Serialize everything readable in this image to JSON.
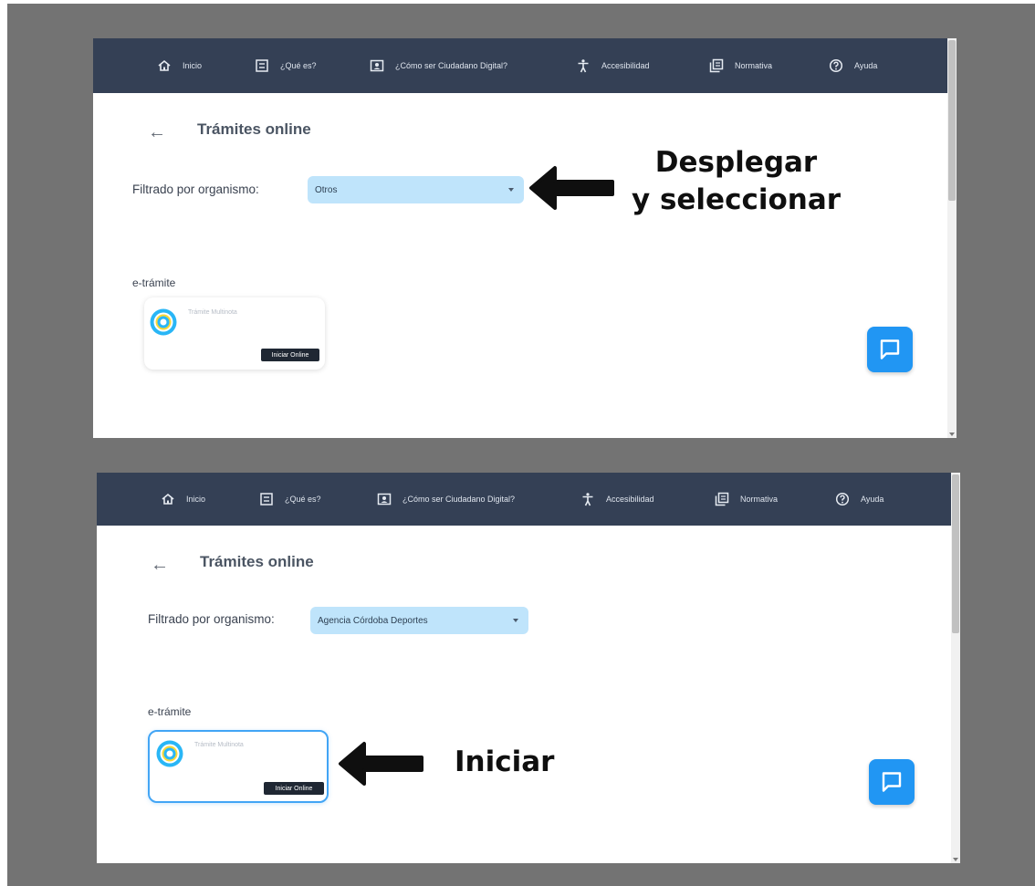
{
  "nav": {
    "items": [
      {
        "label": "Inicio",
        "icon": "home-icon"
      },
      {
        "label": "¿Qué es?",
        "icon": "list-icon"
      },
      {
        "label": "¿Cómo ser Ciudadano Digital?",
        "icon": "id-card-icon"
      },
      {
        "label": "Accesibilidad",
        "icon": "accessibility-icon"
      },
      {
        "label": "Normativa",
        "icon": "copy-icon"
      },
      {
        "label": "Ayuda",
        "icon": "help-icon"
      }
    ]
  },
  "panels": [
    {
      "back_icon": "←",
      "title": "Trámites online",
      "filter_label": "Filtrado por organismo:",
      "filter_value": "Otros",
      "section_label": "e-trámite",
      "card": {
        "name": "Trámite Multinota",
        "button": "Iniciar Online"
      }
    },
    {
      "back_icon": "←",
      "title": "Trámites online",
      "filter_label": "Filtrado por organismo:",
      "filter_value": "Agencia Córdoba Deportes",
      "section_label": "e-trámite",
      "card": {
        "name": "Trámite Multinota",
        "button": "Iniciar Online"
      }
    }
  ],
  "annotations": {
    "top_line1": "Desplegar",
    "top_line2": "y seleccionar",
    "bottom": "Iniciar"
  },
  "colors": {
    "background": "#737373",
    "navbar": "#344055",
    "select": "#bfe4fb",
    "accent": "#2196f3",
    "button": "#1f2733"
  }
}
